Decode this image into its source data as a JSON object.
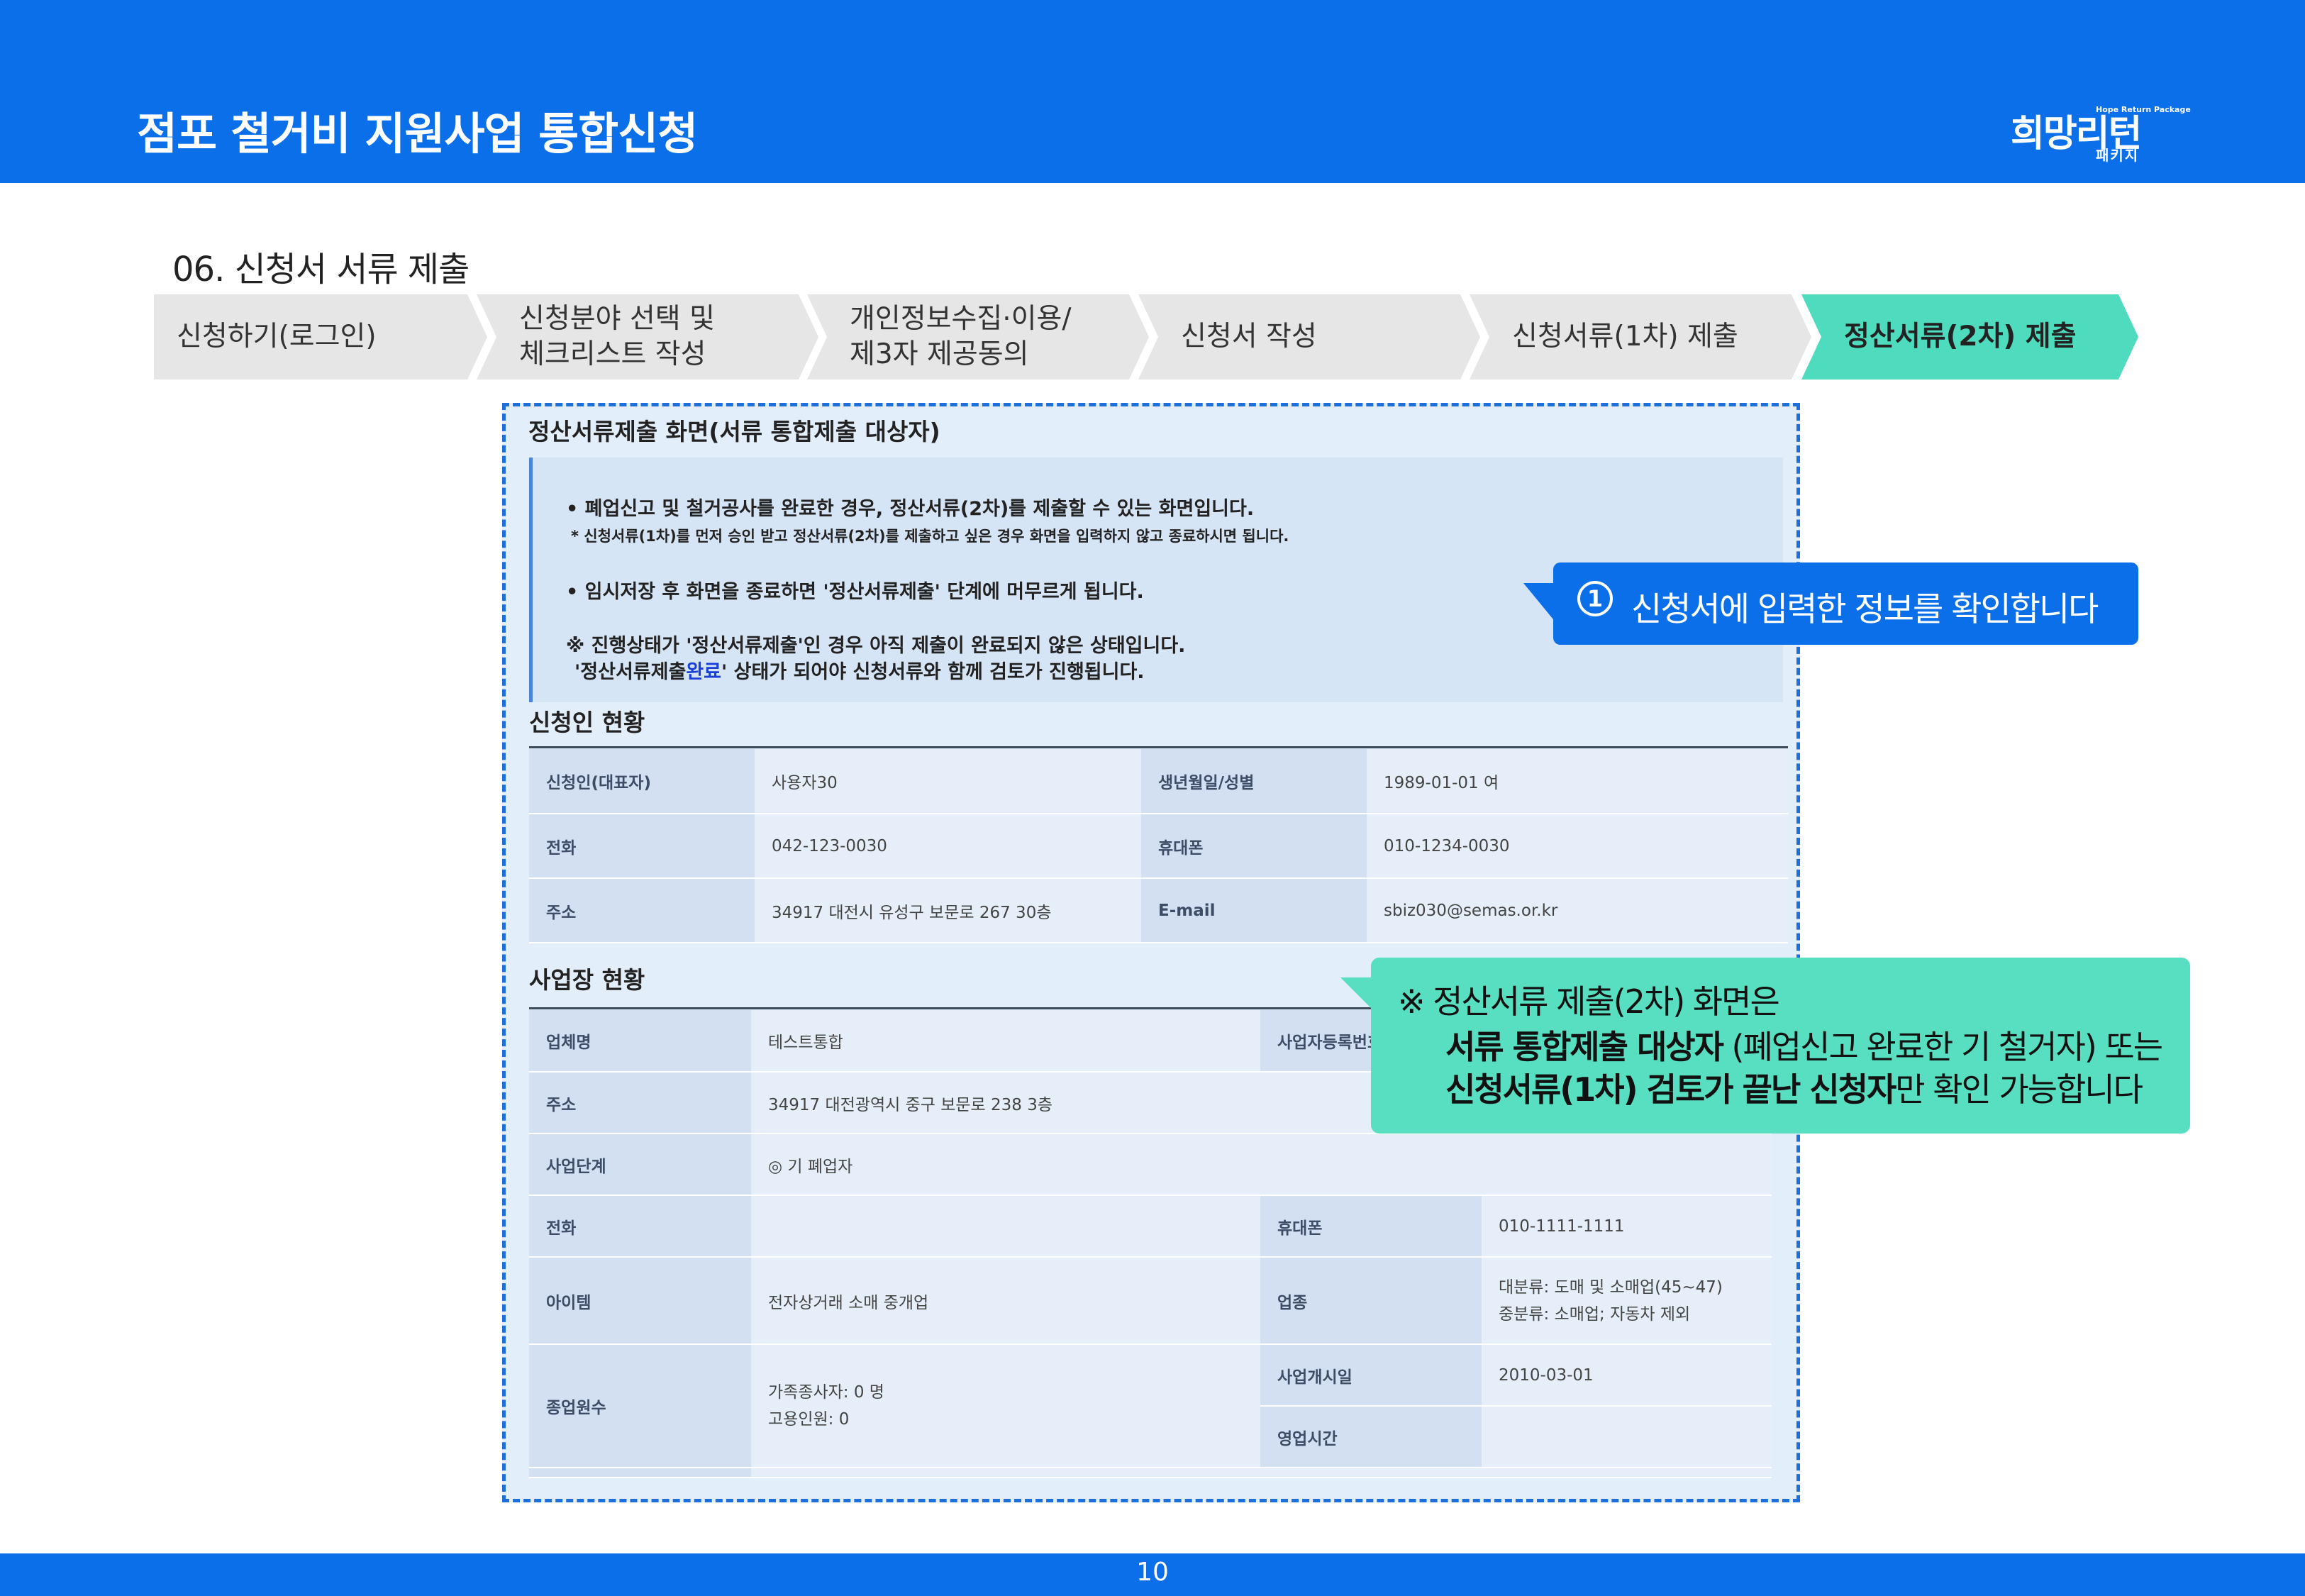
{
  "header": {
    "title": "점포 철거비 지원사업 통합신청"
  },
  "logo": {
    "main": "희망리턴",
    "sub_en": "Hope Return Package",
    "sub_ko": "패키지"
  },
  "section_title": "06. 신청서 서류 제출",
  "steps": [
    {
      "label": "신청하기(로그인)"
    },
    {
      "label": "신청분야 선택 및\n체크리스트 작성"
    },
    {
      "label": "개인정보수집·이용/\n제3자 제공동의"
    },
    {
      "label": "신청서 작성"
    },
    {
      "label": "신청서류(1차) 제출"
    },
    {
      "label": "정산서류(2차) 제출"
    }
  ],
  "screen": {
    "title": "정산서류제출 화면(서류 통합제출 대상자)",
    "notice": {
      "line1": "• 폐업신고 및 철거공사를 완료한 경우, 정산서류(2차)를 제출할 수 있는 화면입니다.",
      "line2": "* 신청서류(1차)를 먼저 승인 받고 정산서류(2차)를 제출하고 싶은 경우 화면을 입력하지 않고 종료하시면 됩니다.",
      "line3": "• 임시저장 후 화면을 종료하면 '정산서류제출' 단계에 머무르게 됩니다.",
      "line4": "※ 진행상태가 '정산서류제출'인 경우 아직 제출이 완료되지 않은 상태입니다.",
      "line5_pre": "'정산서류제출",
      "line5_blue": "완료",
      "line5_post": "' 상태가 되어야 신청서류와 함께 검토가 진행됩니다."
    },
    "applicant": {
      "heading": "신청인 현황",
      "rows": [
        {
          "l1": "신청인(대표자)",
          "v1": "사용자30",
          "l2": "생년월일/성별",
          "v2": "1989-01-01 여"
        },
        {
          "l1": "전화",
          "v1": "042-123-0030",
          "l2": "휴대폰",
          "v2": "010-1234-0030"
        },
        {
          "l1": "주소",
          "v1": "34917 대전시 유성구 보문로 267 30층",
          "l2": "E-mail",
          "v2": "sbiz030@semas.or.kr"
        }
      ]
    },
    "business": {
      "heading": "사업장 현황",
      "name_label": "업체명",
      "name_value": "테스트통합",
      "regno_label": "사업자등록번호",
      "addr_label": "주소",
      "addr_value": "34917 대전광역시 중구 보문로 238 3층",
      "stage_label": "사업단계",
      "stage_value": "◎ 기 폐업자",
      "phone_label": "전화",
      "phone_value": "",
      "mobile_label": "휴대폰",
      "mobile_value": "010-1111-1111",
      "item_label": "아이템",
      "item_value": "전자상거래 소매 중개업",
      "industry_label": "업종",
      "industry_value1": "대분류: 도매 및 소매업(45~47)",
      "industry_value2": "중분류: 소매업; 자동차 제외",
      "staff_label": "종업원수",
      "staff_value1": "가족종사자: 0 명",
      "staff_value2": "고용인원: 0",
      "open_label": "사업개시일",
      "open_value": "2010-03-01",
      "hours_label": "영업시간",
      "hours_value": ""
    }
  },
  "callout1": {
    "num": "1",
    "text": "신청서에 입력한 정보를 확인합니다"
  },
  "callout2": {
    "line1": "※ 정산서류 제출(2차) 화면은",
    "line2_bold": "서류 통합제출 대상자",
    "line2_rest": " (폐업신고 완료한 기 철거자) 또는",
    "line3_bold": "신청서류(1차) 검토가 끝난 신청자",
    "line3_rest": "만 확인 가능합니다"
  },
  "footer": {
    "page": "10"
  },
  "colors": {
    "brand_blue": "#0a6fe9",
    "mint": "#58dec0",
    "step_gray": "#e6e6e6"
  }
}
